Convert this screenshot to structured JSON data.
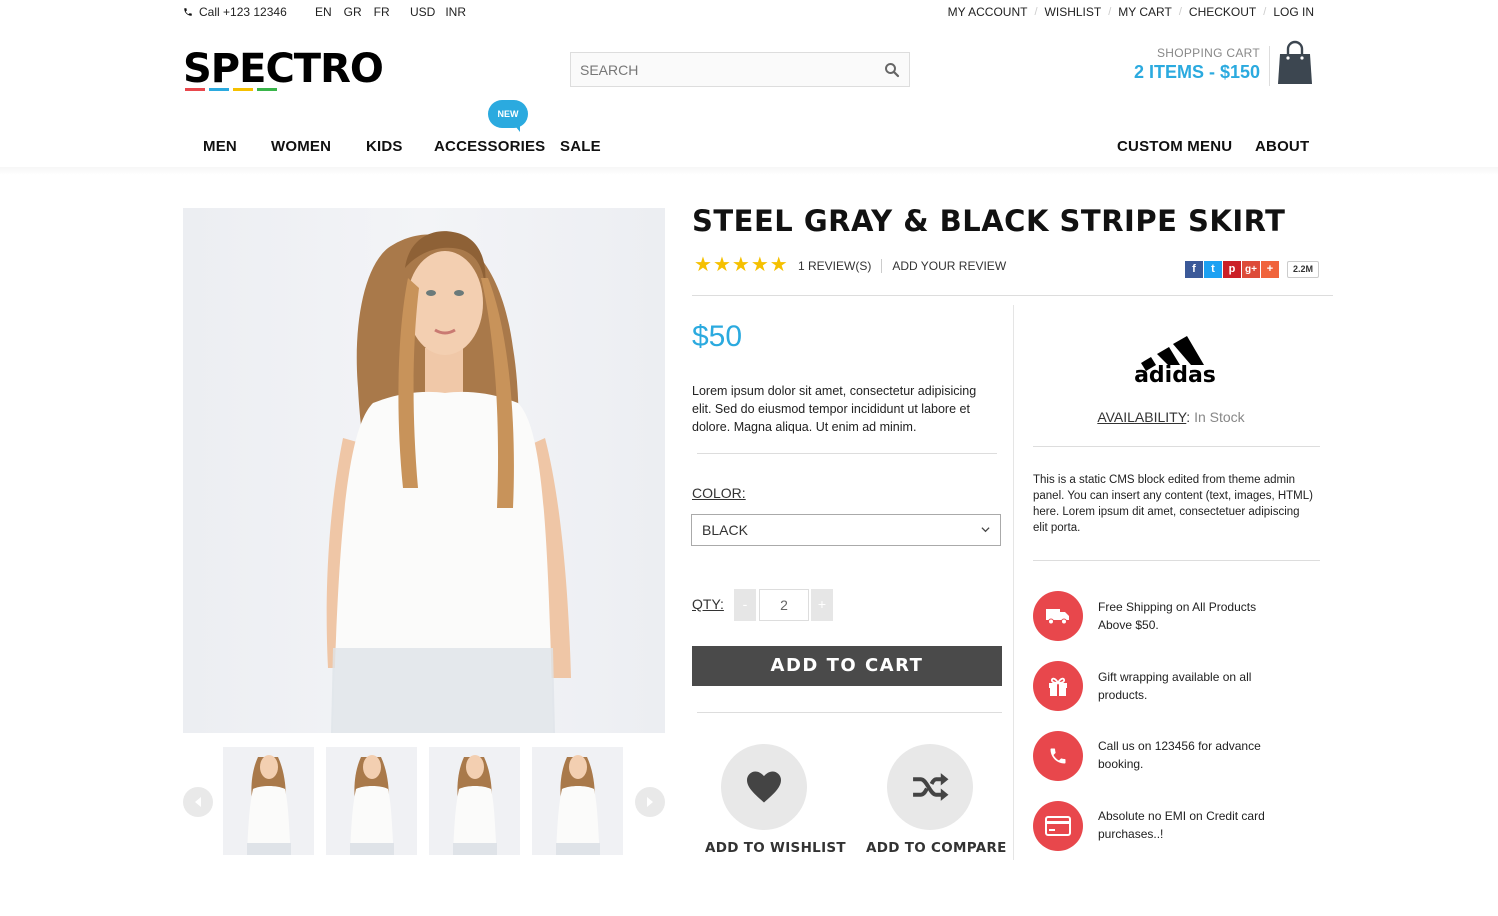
{
  "topbar": {
    "phone": "Call +123 12346",
    "languages": [
      "EN",
      "GR",
      "FR"
    ],
    "currencies": [
      "USD",
      "INR"
    ],
    "account_links": [
      "MY ACCOUNT",
      "WISHLIST",
      "MY CART",
      "CHECKOUT",
      "LOG IN"
    ]
  },
  "logo": {
    "text": "SPECTRO",
    "bar_colors": [
      "#e8474c",
      "#2baadf",
      "#f5c000",
      "#39b54a"
    ]
  },
  "search": {
    "placeholder": "SEARCH"
  },
  "cart": {
    "label": "SHOPPING CART",
    "total": "2 ITEMS - $150"
  },
  "nav": {
    "left": [
      "MEN",
      "WOMEN",
      "KIDS",
      "ACCESSORIES",
      "SALE"
    ],
    "right": [
      "CUSTOM MENU",
      "ABOUT"
    ],
    "badge": "NEW"
  },
  "product": {
    "title": "STEEL GRAY & BLACK STRIPE SKIRT",
    "rating": 5,
    "reviews_link": "1 REVIEW(S)",
    "add_review_link": "ADD YOUR REVIEW",
    "share_count": "2.2M",
    "price": "$50",
    "description": "Lorem ipsum dolor sit amet, consectetur adipisicing elit. Sed do eiusmod tempor incididunt ut labore et dolore. Magna aliqua. Ut enim ad minim.",
    "color_label": "COLOR:",
    "color_value": "BLACK",
    "qty_label": "QTY:",
    "qty_value": "2",
    "qty_minus": "-",
    "qty_plus": "+",
    "add_to_cart": "ADD TO CART",
    "wishlist_label": "ADD TO WISHLIST",
    "compare_label": "ADD TO COMPARE"
  },
  "sidebar": {
    "brand": "adidas",
    "availability_label": "AVAILABILITY",
    "availability_value": "In Stock",
    "cms_text": "This is a static CMS block edited from theme admin panel. You can insert any content (text, images, HTML) here. Lorem ipsum dit amet, consectetuer adipiscing elit porta.",
    "features": [
      {
        "icon": "truck-icon",
        "text": "Free Shipping on All Products Above $50."
      },
      {
        "icon": "gift-icon",
        "text": "Gift wrapping available on all products."
      },
      {
        "icon": "phone-icon",
        "text": "Call us on 123456 for advance booking."
      },
      {
        "icon": "credit-card-icon",
        "text": "Absolute no EMI on Credit card purchases..!"
      }
    ]
  },
  "colors": {
    "accent": "#2baadf",
    "feature_red": "#e8474c",
    "button_dark": "#4a4a4a",
    "star": "#f5c000"
  }
}
